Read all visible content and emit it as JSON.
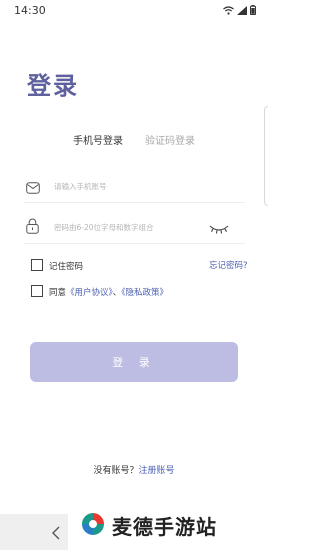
{
  "status_bar": {
    "time": "14:30",
    "icons": [
      "wifi-icon",
      "signal-icon",
      "battery-icon"
    ]
  },
  "page": {
    "title": "登录"
  },
  "tabs": {
    "phone_login": "手机号登录",
    "code_login": "验证码登录"
  },
  "form": {
    "phone_placeholder": "请输入手机账号",
    "password_placeholder": "密码由6-20位字母和数字组合"
  },
  "options": {
    "remember_label": "记住密码",
    "forgot_label": "忘记密码?",
    "agree_prefix": "同意",
    "user_agreement": "《用户协议》",
    "separator": "、",
    "privacy_policy": "《隐私政策》"
  },
  "actions": {
    "login_button": "登 录"
  },
  "footer": {
    "no_account_text": "没有账号？",
    "register_link": "注册账号"
  },
  "watermark": {
    "text": "麦德手游站"
  },
  "colors": {
    "brand": "#5f619f",
    "button": "#bdbde4",
    "link": "#4a5fb0"
  }
}
